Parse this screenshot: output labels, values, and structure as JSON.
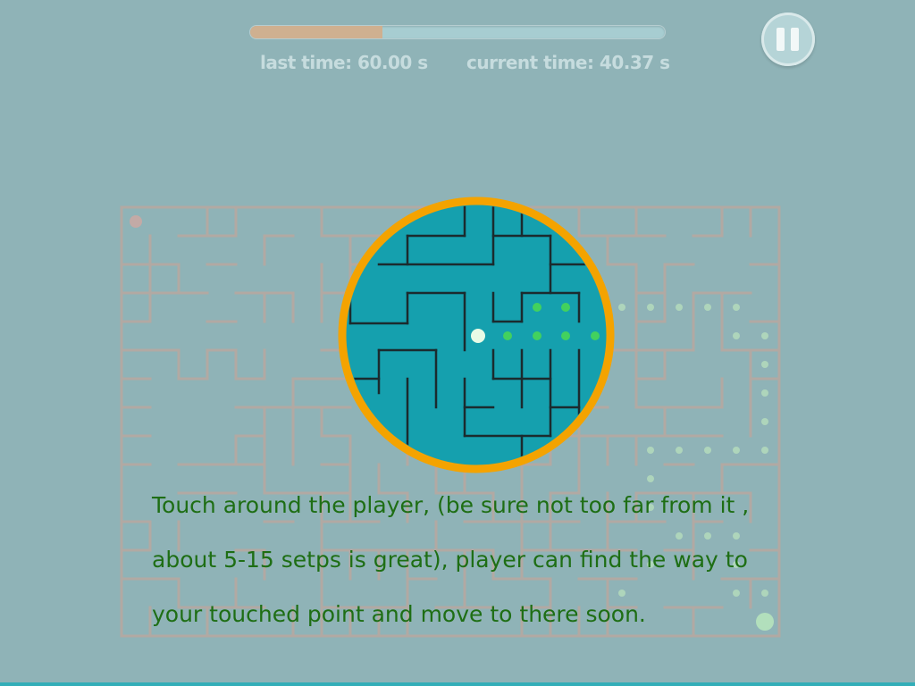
{
  "hud": {
    "last_time_text": "last time: 60.00 s",
    "current_time_text": "current time: 40.37 s",
    "progress_fraction": 0.32,
    "pause_icon": "pause-icon"
  },
  "instructions": {
    "line1": "Touch around the player, (be sure not too far from it ,",
    "line2": "about 5-15 setps is great), player can find the way to",
    "line3": "your touched point and move to there soon."
  },
  "colors": {
    "background": "#8fb3b7",
    "maze_wall": "#b2a9a3",
    "magnifier_ring": "#f4a300",
    "magnifier_fill": "#15a0ae",
    "magnified_wall": "#1b2b2e",
    "path_dot": "#45d45a",
    "player": "#e8fbe6",
    "instruction_text": "#1e6e14",
    "progress_fill": "#cfb090",
    "time_text": "#c6dcde"
  }
}
